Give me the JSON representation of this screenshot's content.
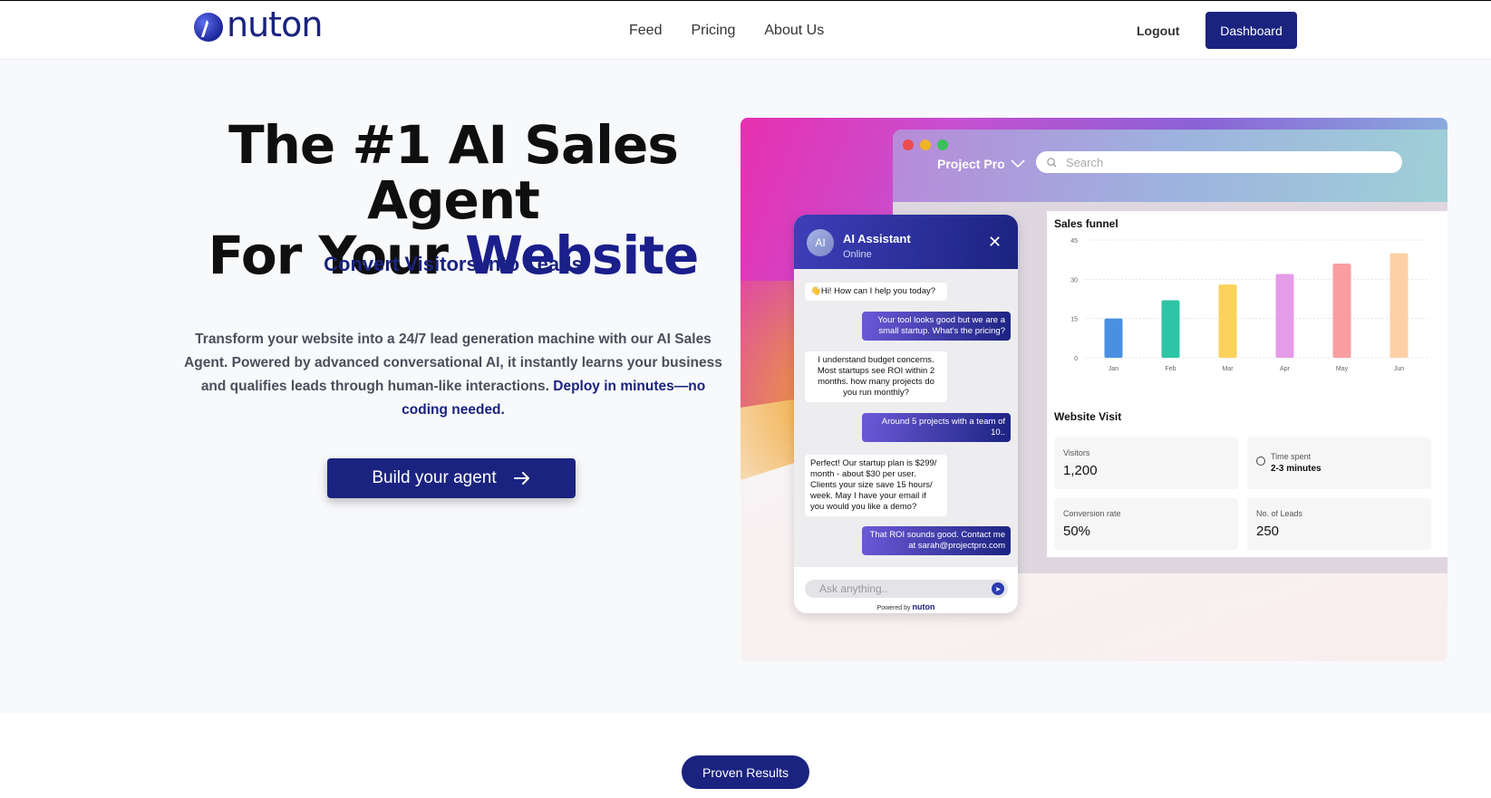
{
  "header": {
    "logo_text": "nuton",
    "nav": [
      "Feed",
      "Pricing",
      "About Us"
    ],
    "logout_label": "Logout",
    "dashboard_label": "Dashboard"
  },
  "hero": {
    "title_line1": "The #1 AI Sales Agent",
    "title_line2_prefix": "For Your ",
    "title_line2_accent": "Website",
    "subtitle": "Convert Visitors Into Leads",
    "description": "Transform your website into a 24/7 lead generation machine with our AI Sales Agent. Powered by advanced conversational AI, it instantly learns your business and qualifies leads through human-like interactions. ",
    "description_highlight": "Deploy in minutes—no coding needed.",
    "cta_label": "Build your agent",
    "cta_icon": "arrow-right-icon"
  },
  "mockup": {
    "project_name": "Project Pro",
    "search_placeholder": "Search",
    "window_dot_colors": [
      "#ec4c4c",
      "#f0b429",
      "#3ac05a"
    ],
    "sales_funnel": {
      "title": "Sales funnel"
    },
    "website_visit": {
      "title": "Website Visit",
      "stats": [
        {
          "label": "Visitors",
          "value": "1,200"
        },
        {
          "label": "Time spent",
          "value": "2-3 minutes"
        },
        {
          "label": "Conversion rate",
          "value": "50%"
        },
        {
          "label": "No. of Leads",
          "value": "250"
        }
      ]
    },
    "chat": {
      "avatar": "AI",
      "name": "AI Assistant",
      "status": "Online",
      "messages": [
        {
          "from": "bot",
          "text": "👋Hi! How can I help you today?"
        },
        {
          "from": "user",
          "text": "Your tool looks good but we are a small startup. What's the pricing?"
        },
        {
          "from": "bot",
          "text": "I understand budget concerns. Most startups see ROI within 2 months. how many projects do you run monthly?"
        },
        {
          "from": "user",
          "text": "Around 5 projects with a team of 10.."
        },
        {
          "from": "bot",
          "text": "Perfect! Our startup plan is $299/ month - about $30 per user. Clients your size save 15 hours/ week. May I have your email if you would you like a demo?"
        },
        {
          "from": "user",
          "text": "That ROI sounds good. Contact me at sarah@projectpro.com"
        }
      ],
      "input_placeholder": "Ask anything..",
      "powered_by": "Powered by",
      "powered_brand": "nuton"
    }
  },
  "chart_data": {
    "type": "bar",
    "title": "Sales funnel",
    "categories": [
      "Jan",
      "Feb",
      "Mar",
      "Apr",
      "May",
      "Jun"
    ],
    "values": [
      15,
      22,
      28,
      32,
      36,
      40
    ],
    "colors": [
      "#4a90e2",
      "#2ec4a6",
      "#fbd25a",
      "#e59ce8",
      "#f99ea0",
      "#fdd0a6"
    ],
    "yticks": [
      0,
      15,
      30,
      45
    ],
    "ylim": [
      0,
      45
    ]
  },
  "footer": {
    "proven_label": "Proven Results"
  }
}
